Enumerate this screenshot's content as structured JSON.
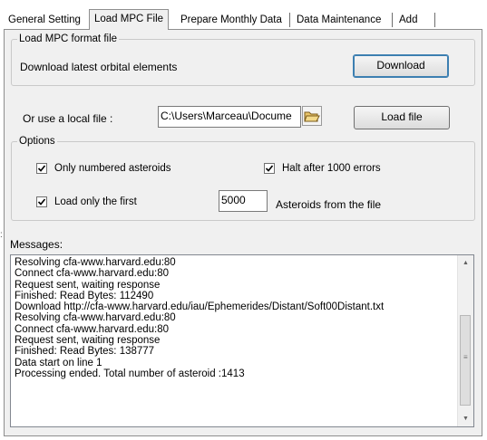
{
  "tabs": [
    {
      "label": "General Setting",
      "active": false
    },
    {
      "label": "Load MPC File",
      "active": true
    },
    {
      "label": "Prepare Monthly Data",
      "active": false
    },
    {
      "label": "Data Maintenance",
      "active": false
    },
    {
      "label": "Add",
      "active": false
    }
  ],
  "load_mpc": {
    "group_title": "Load MPC format file",
    "download_text": "Download latest orbital elements",
    "download_button": "Download"
  },
  "local_file": {
    "label": "Or use a local file :",
    "path_value": "C:\\Users\\Marceau\\Docume",
    "browse_icon": "folder-open-icon",
    "load_button": "Load file"
  },
  "options": {
    "group_title": "Options",
    "only_numbered": {
      "label": "Only numbered asteroids",
      "checked": true
    },
    "halt_after": {
      "label": "Halt after 1000 errors",
      "checked": true
    },
    "load_first": {
      "label": "Load only the first",
      "checked": true
    },
    "count_value": "5000",
    "count_suffix": "Asteroids from the file"
  },
  "messages": {
    "label": "Messages:",
    "lines": [
      "Resolving cfa-www.harvard.edu:80",
      "Connect cfa-www.harvard.edu:80",
      "Request sent, waiting response",
      "Finished: Read Bytes: 112490",
      "Download http://cfa-www.harvard.edu/iau/Ephemerides/Distant/Soft00Distant.txt",
      "Resolving cfa-www.harvard.edu:80",
      "Connect cfa-www.harvard.edu:80",
      "Request sent, waiting response",
      "Finished: Read Bytes: 138777",
      "Data start on line 1",
      "Processing ended. Total number of asteroid :1413"
    ]
  },
  "colors": {
    "panel": "#f0f0f0",
    "border": "#8e8e8e",
    "accent": "#3c7fb1"
  }
}
